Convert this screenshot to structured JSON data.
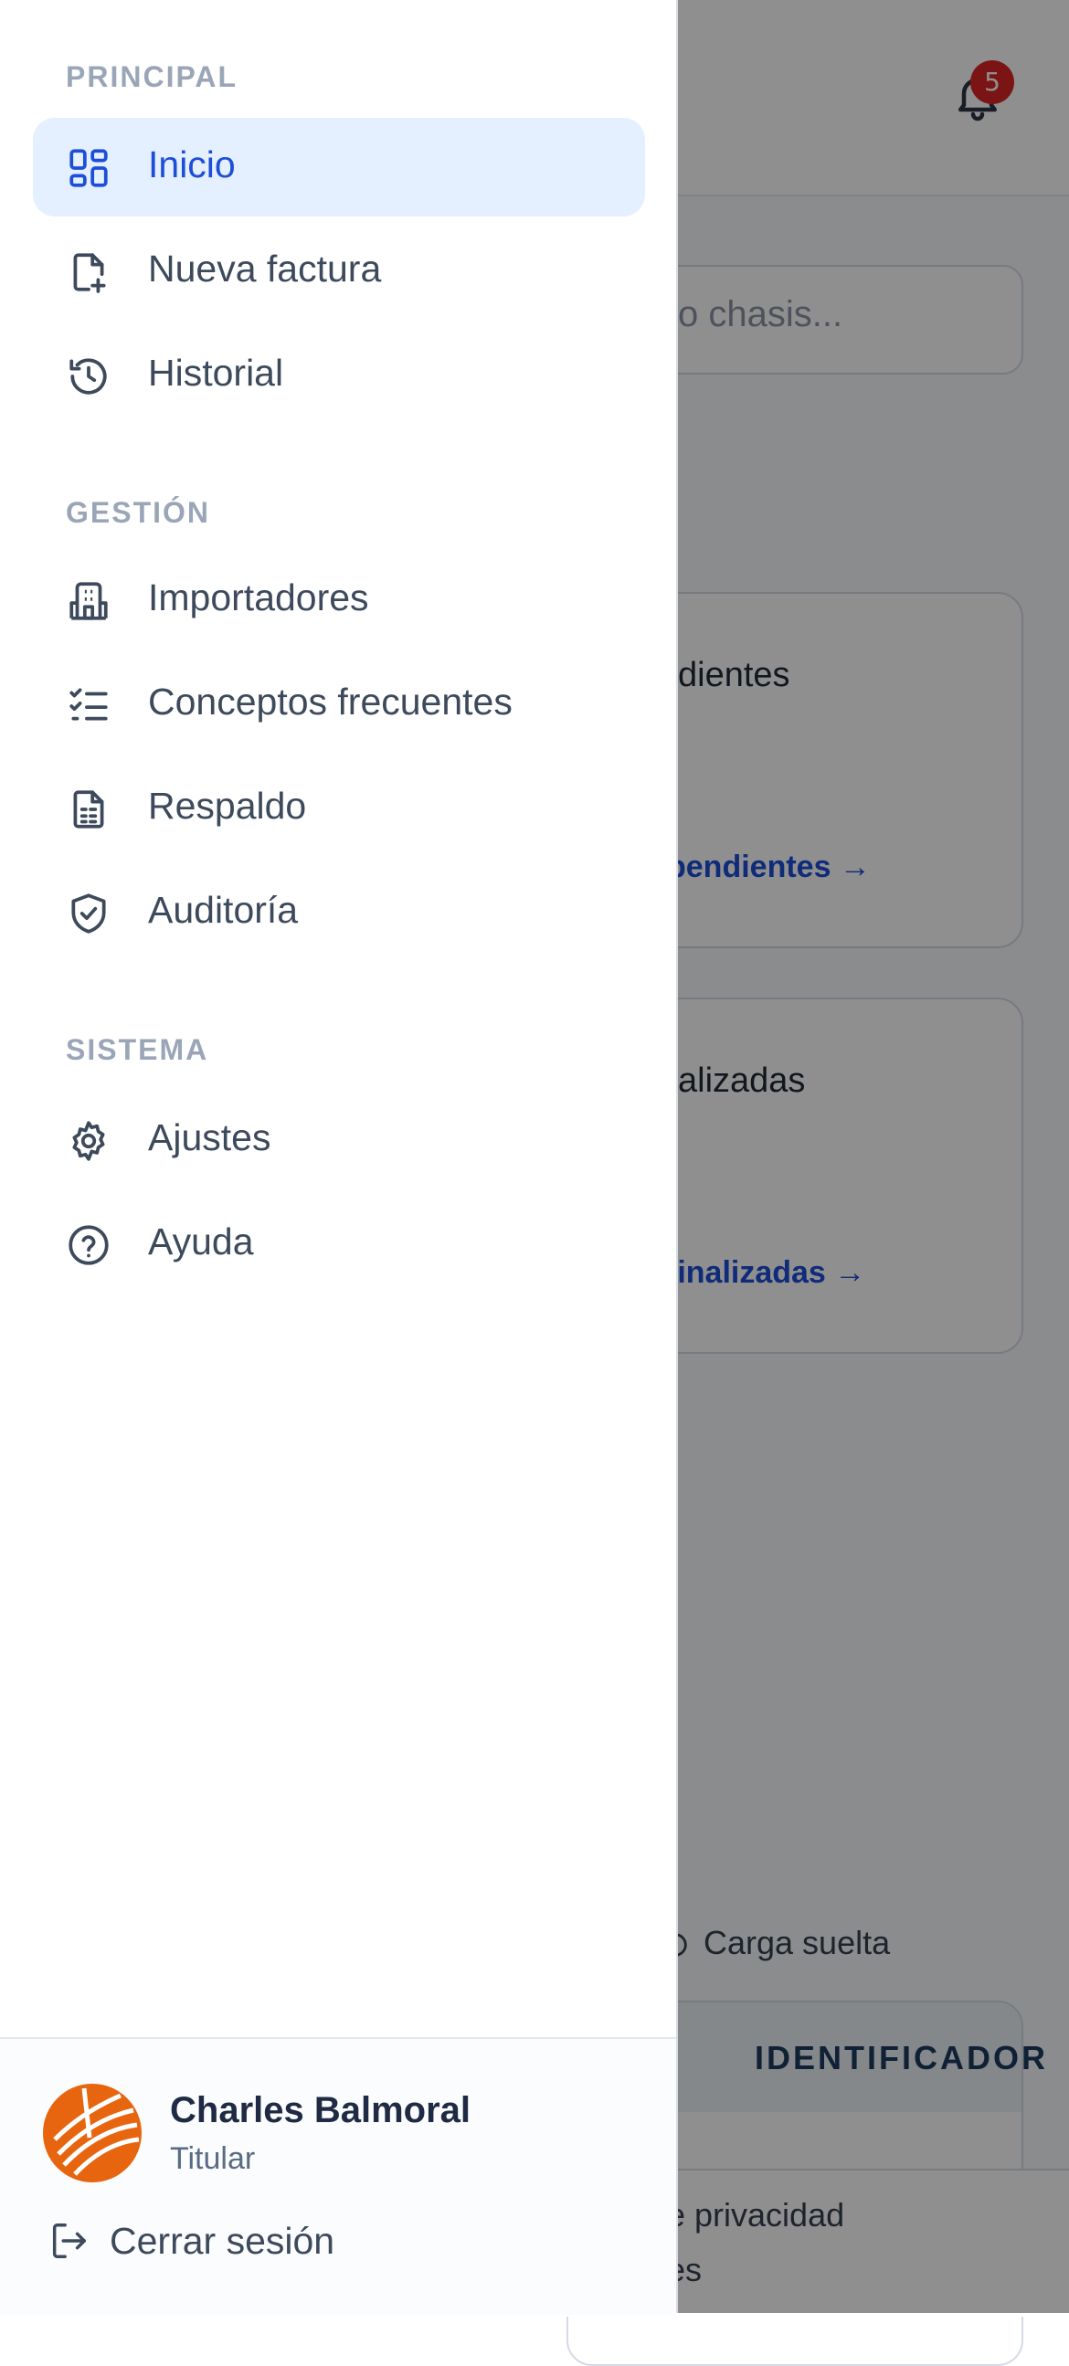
{
  "background": {
    "notifications_count": "5",
    "search_placeholder_visible": "o chasis...",
    "card_pending_title": "dientes",
    "card_pending_link": "pendientes →",
    "card_done_title": "alizadas",
    "card_done_link": "finalizadas →",
    "filter_label": "Carga suelta",
    "table_header": "IDENTIFICADOR",
    "footer_line1": "e privacidad",
    "footer_line2": "es"
  },
  "drawer": {
    "sections": {
      "principal": "PRINCIPAL",
      "gestion": "GESTIÓN",
      "sistema": "SISTEMA"
    },
    "items": {
      "inicio": "Inicio",
      "nueva_factura": "Nueva factura",
      "historial": "Historial",
      "importadores": "Importadores",
      "conceptos": "Conceptos frecuentes",
      "respaldo": "Respaldo",
      "auditoria": "Auditoría",
      "ajustes": "Ajustes",
      "ayuda": "Ayuda"
    },
    "active_item": "Inicio",
    "user": {
      "name": "Charles Balmoral",
      "role": "Titular"
    },
    "logout_label": "Cerrar sesión"
  },
  "colors": {
    "accent": "#1d4ed8",
    "active_bg": "#e4efff",
    "badge": "#dc2626",
    "avatar": "#e8650f"
  }
}
